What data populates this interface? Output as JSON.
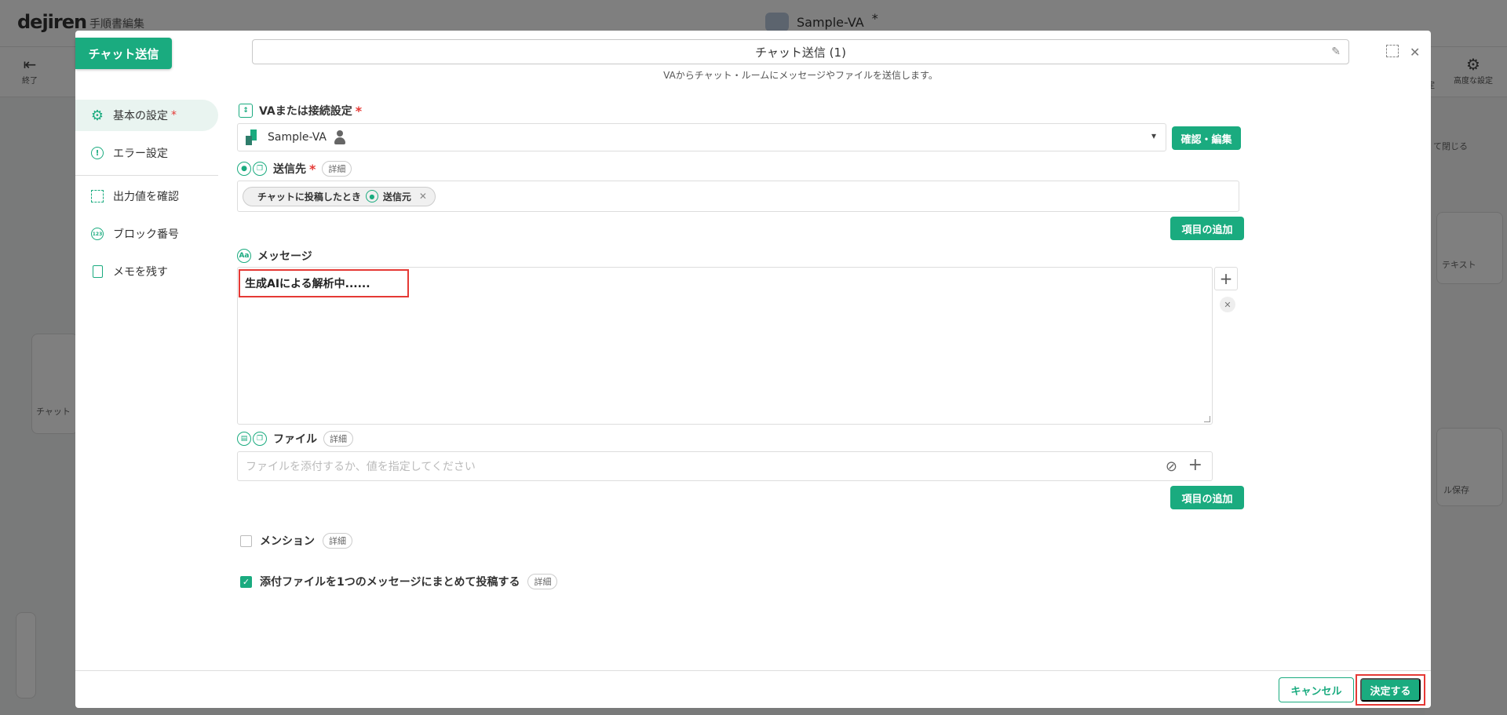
{
  "background": {
    "logo": "dejiren",
    "subtitle": "手順書編集",
    "title": "Sample-VA",
    "title_marker": "*",
    "tools": {
      "exit": "終了",
      "advanced": "高度な設定",
      "settings_partial": "定"
    },
    "right_close_label": "て閉じる",
    "card_text_1": "テキスト",
    "card_text_2": "ル保存",
    "left_card_label": "チャット"
  },
  "modal": {
    "badge": "チャット送信",
    "title": "チャット送信 (1)",
    "description": "VAからチャット・ルームにメッセージやファイルを送信します。",
    "sidebar": {
      "items": [
        {
          "label": "基本の設定",
          "required": "*"
        },
        {
          "label": "エラー設定"
        },
        {
          "label": "出力値を確認"
        },
        {
          "label": "ブロック番号"
        },
        {
          "label": "メモを残す"
        }
      ]
    },
    "va": {
      "label": "VAまたは接続設定",
      "required": "*",
      "value": "Sample-VA",
      "confirm_button": "確認・編集"
    },
    "destination": {
      "label": "送信先",
      "required": "*",
      "detail": "詳細",
      "tag_trigger": "チャットに投稿したとき",
      "tag_value": "送信元",
      "add_button": "項目の追加"
    },
    "message": {
      "label": "メッセージ",
      "value": "生成AIによる解析中......"
    },
    "file": {
      "label": "ファイル",
      "detail": "詳細",
      "placeholder": "ファイルを添付するか、値を指定してください",
      "add_button": "項目の追加"
    },
    "mention": {
      "label": "メンション",
      "detail": "詳細",
      "checked": false
    },
    "bundle": {
      "label": "添付ファイルを1つのメッセージにまとめて投稿する",
      "detail": "詳細",
      "checked": true
    },
    "footer": {
      "cancel": "キャンセル",
      "ok": "決定する"
    }
  },
  "colors": {
    "accent": "#1aab7f",
    "required": "#e53935",
    "highlight": "#e53935"
  }
}
